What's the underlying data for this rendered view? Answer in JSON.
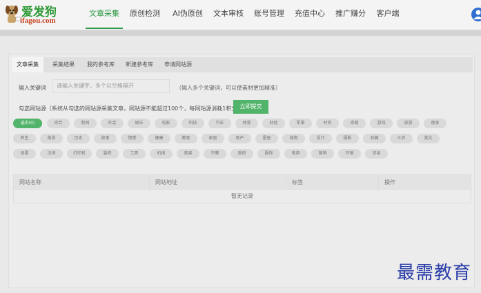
{
  "logo": {
    "title": "爱发狗",
    "domain": "ifagou.com"
  },
  "nav": {
    "items": [
      {
        "label": "文章采集",
        "active": true
      },
      {
        "label": "原创检测",
        "active": false
      },
      {
        "label": "AI伪原创",
        "active": false
      },
      {
        "label": "文本审核",
        "active": false
      },
      {
        "label": "账号管理",
        "active": false
      },
      {
        "label": "充值中心",
        "active": false
      },
      {
        "label": "推广赚分",
        "active": false
      },
      {
        "label": "客户端",
        "active": false
      }
    ]
  },
  "tabs": [
    {
      "label": "文章采集",
      "active": true
    },
    {
      "label": "采集结果",
      "active": false
    },
    {
      "label": "我的参考库",
      "active": false
    },
    {
      "label": "新建参考库",
      "active": false
    },
    {
      "label": "申请网站源",
      "active": false
    }
  ],
  "keyword": {
    "label": "输入关键词",
    "placeholder": "请输入关键字，多个以空格隔开",
    "hint": "（输入多个关键词，可以使素材更加精准）"
  },
  "sites": {
    "label": "勾选网站源（系统从勾选的网站源采集文章，网站源不能超过100个，每网站源消耗1积分）",
    "submit_label": "立即提交"
  },
  "categories": [
    {
      "label": "选中(0)",
      "selected": true
    },
    {
      "label": "综合",
      "selected": false
    },
    {
      "label": "新闻",
      "selected": false
    },
    {
      "label": "社会",
      "selected": false
    },
    {
      "label": "娱乐",
      "selected": false
    },
    {
      "label": "电影",
      "selected": false
    },
    {
      "label": "科技",
      "selected": false
    },
    {
      "label": "汽车",
      "selected": false
    },
    {
      "label": "体育",
      "selected": false
    },
    {
      "label": "财经",
      "selected": false
    },
    {
      "label": "军事",
      "selected": false
    },
    {
      "label": "时尚",
      "selected": false
    },
    {
      "label": "奇葩",
      "selected": false
    },
    {
      "label": "游戏",
      "selected": false
    },
    {
      "label": "旅游",
      "selected": false
    },
    {
      "label": "瘦身",
      "selected": false
    },
    {
      "label": "养生",
      "selected": false
    },
    {
      "label": "美食",
      "selected": false
    },
    {
      "label": "历史",
      "selected": false
    },
    {
      "label": "故事",
      "selected": false
    },
    {
      "label": "情感",
      "selected": false
    },
    {
      "label": "健康",
      "selected": false
    },
    {
      "label": "教育",
      "selected": false
    },
    {
      "label": "家居",
      "selected": false
    },
    {
      "label": "房产",
      "selected": false
    },
    {
      "label": "星座",
      "selected": false
    },
    {
      "label": "宠物",
      "selected": false
    },
    {
      "label": "设计",
      "selected": false
    },
    {
      "label": "摄影",
      "selected": false
    },
    {
      "label": "收藏",
      "selected": false
    },
    {
      "label": "三农",
      "selected": false
    },
    {
      "label": "美文",
      "selected": false
    },
    {
      "label": "母婴",
      "selected": false
    },
    {
      "label": "法律",
      "selected": false
    },
    {
      "label": "打印机",
      "selected": false
    },
    {
      "label": "装修",
      "selected": false
    },
    {
      "label": "工具",
      "selected": false
    },
    {
      "label": "机械",
      "selected": false
    },
    {
      "label": "美容",
      "selected": false
    },
    {
      "label": "宗教",
      "selected": false
    },
    {
      "label": "政府",
      "selected": false
    },
    {
      "label": "服饰",
      "selected": false
    },
    {
      "label": "电商",
      "selected": false
    },
    {
      "label": "营销",
      "selected": false
    },
    {
      "label": "环境",
      "selected": false
    },
    {
      "label": "贸易",
      "selected": false
    }
  ],
  "table": {
    "columns": [
      "网站名称",
      "网站地址",
      "标签",
      "操作"
    ],
    "empty_text": "暂无记录"
  },
  "watermark": "最需教育",
  "colors": {
    "accent": "#52b36a",
    "watermark": "#2b3ea8",
    "logo_green": "#2e9a36",
    "logo_red": "#c7401e"
  }
}
